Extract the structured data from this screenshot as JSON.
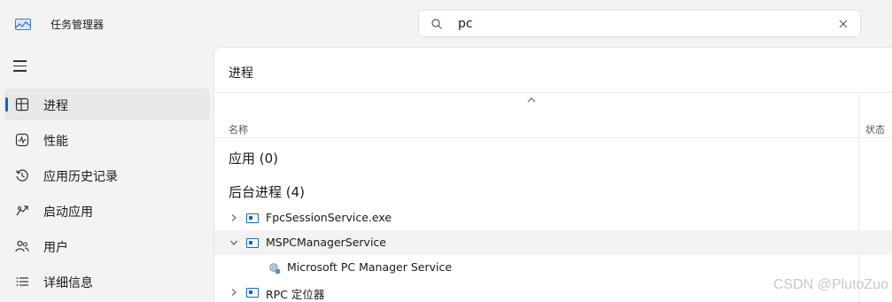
{
  "app": {
    "title": "任务管理器",
    "icon": "task-manager-icon"
  },
  "search": {
    "value": "pc",
    "icon": "search-icon",
    "clear_icon": "close-icon"
  },
  "sidebar": {
    "menu_icon": "hamburger-icon",
    "items": [
      {
        "label": "进程",
        "icon": "processes-icon",
        "active": true
      },
      {
        "label": "性能",
        "icon": "performance-icon",
        "active": false
      },
      {
        "label": "应用历史记录",
        "icon": "history-icon",
        "active": false
      },
      {
        "label": "启动应用",
        "icon": "startup-icon",
        "active": false
      },
      {
        "label": "用户",
        "icon": "users-icon",
        "active": false
      },
      {
        "label": "详细信息",
        "icon": "details-icon",
        "active": false
      }
    ]
  },
  "main": {
    "title": "进程",
    "columns": {
      "name": "名称",
      "status": "状态"
    },
    "groups": [
      {
        "label": "应用 (0)"
      },
      {
        "label": "后台进程 (4)"
      }
    ],
    "rows": [
      {
        "label": "FpcSessionService.exe",
        "expanded": false
      },
      {
        "label": "MSPCManagerService",
        "expanded": true
      },
      {
        "label": "Microsoft PC Manager Service",
        "child": true
      },
      {
        "label": "RPC 定位器",
        "expanded": false
      }
    ]
  },
  "watermark": "CSDN @PlutoZuo",
  "colors": {
    "accent": "#1565c0",
    "background": "#f3f3f3",
    "panel": "#ffffff"
  }
}
